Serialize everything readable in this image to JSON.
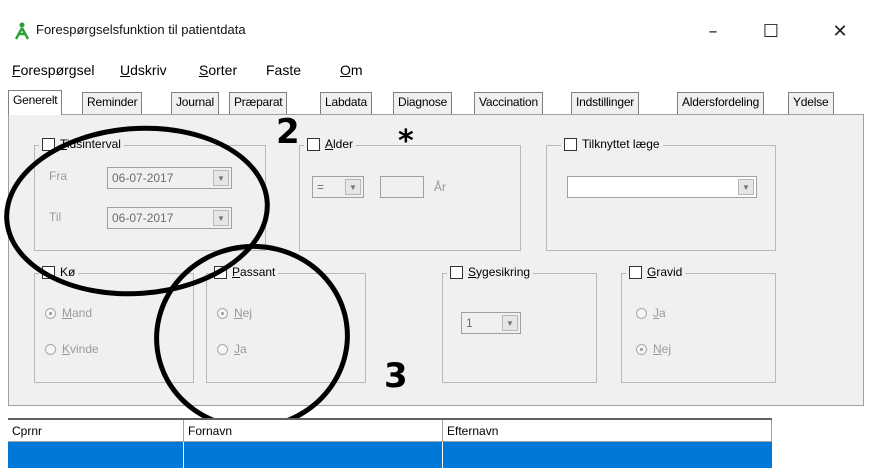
{
  "window": {
    "title": "Forespørgselsfunktion til patientdata",
    "minimize": "–",
    "maximize": "☐",
    "close": "✕",
    "icon": "person-arrows-icon",
    "accent": "#0078d7"
  },
  "menu": [
    "Forespørgsel",
    "Udskriv",
    "Sorter",
    "Faste",
    "Om"
  ],
  "tabs": [
    "Generelt",
    "Reminder",
    "Journal",
    "Præparat",
    "Labdata",
    "Diagnose",
    "Vaccination",
    "Indstillinger",
    "Aldersfordeling",
    "Ydelse"
  ],
  "tidsinterval": {
    "label": "Tidsinterval",
    "fra_label": "Fra",
    "fra_value": "06-07-2017",
    "til_label": "Til",
    "til_value": "06-07-2017"
  },
  "alder": {
    "label": "Alder",
    "operator": "=",
    "value": "",
    "unit": "År"
  },
  "tilknyttet": {
    "label": "Tilknyttet læge",
    "value": ""
  },
  "koen": {
    "label": "Kø",
    "options": [
      "Mand",
      "Kvinde"
    ],
    "selected": "Mand"
  },
  "passant": {
    "label": "Passant",
    "options": [
      "Nej",
      "Ja"
    ],
    "selected": "Nej"
  },
  "sygesikring": {
    "label": "Sygesikring",
    "value": "1"
  },
  "gravid": {
    "label": "Gravid",
    "options": [
      "Ja",
      "Nej"
    ],
    "selected": "Nej"
  },
  "annotations": {
    "two": "2",
    "star": "*",
    "three": "3"
  },
  "table": {
    "columns": [
      "Cprnr",
      "Fornavn",
      "Efternavn"
    ]
  }
}
